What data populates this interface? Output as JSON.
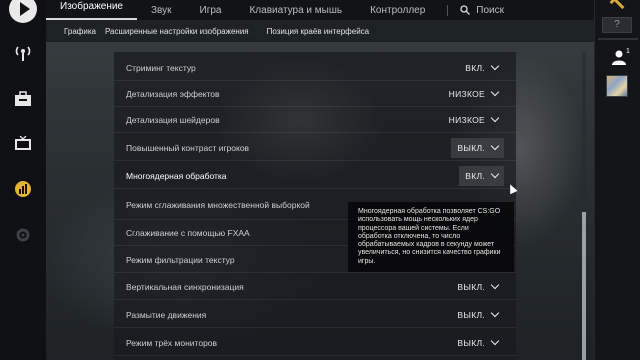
{
  "top_nav": {
    "tabs": [
      {
        "label": "Изображение",
        "active": true
      },
      {
        "label": "Звук"
      },
      {
        "label": "Игра"
      },
      {
        "label": "Клавиатура и мышь"
      },
      {
        "label": "Контроллер"
      }
    ],
    "search_label": "Поиск",
    "search_icon": "search-icon"
  },
  "sub_nav": {
    "tabs": [
      {
        "label": "Графика"
      },
      {
        "label": "Расширенные настройки изображения"
      },
      {
        "label": "Позиция краёв интерфейса"
      }
    ]
  },
  "sidebar": {
    "items": [
      {
        "icon": "play-icon"
      },
      {
        "icon": "broadcast-icon"
      },
      {
        "icon": "inventory-icon"
      },
      {
        "icon": "tv-icon"
      },
      {
        "icon": "stats-icon"
      },
      {
        "icon": "settings-gear-icon"
      }
    ]
  },
  "settings": {
    "rows": [
      {
        "label": "Стриминг текстур",
        "value": "ВКЛ."
      },
      {
        "label": "Детализация эффектов",
        "value": "НИЗКОЕ"
      },
      {
        "label": "Детализация шейдеров",
        "value": "НИЗКОЕ"
      },
      {
        "label": "Повышенный контраст игроков",
        "value": "ВЫКЛ."
      },
      {
        "label": "Многоядерная обработка",
        "value": "ВКЛ."
      },
      {
        "label": "Режим сглаживания множественной выборкой",
        "value": ""
      },
      {
        "label": "Сглаживание с помощью FXAA",
        "value": ""
      },
      {
        "label": "Режим фильтрации текстур",
        "value": ""
      },
      {
        "label": "Вертикальная синхронизация",
        "value": "ВЫКЛ."
      },
      {
        "label": "Размытие движения",
        "value": "ВЫКЛ."
      },
      {
        "label": "Режим трёх мониторов",
        "value": "ВЫКЛ."
      }
    ]
  },
  "tooltip": {
    "text": "Многоядерная обработка позволяет CS:GO использовать мощь нескольких ядер процессора вашей системы. Если обработка отключена, то число обрабатываемых кадров в секунду может увеличиться, но снизится качество графики игры."
  },
  "right_bar": {
    "help_label": "?",
    "friends_count": "1",
    "rank_color": "#d8a93a"
  },
  "colors": {
    "accent": "#d9d9d9",
    "panel_bg": "#181b1e"
  }
}
